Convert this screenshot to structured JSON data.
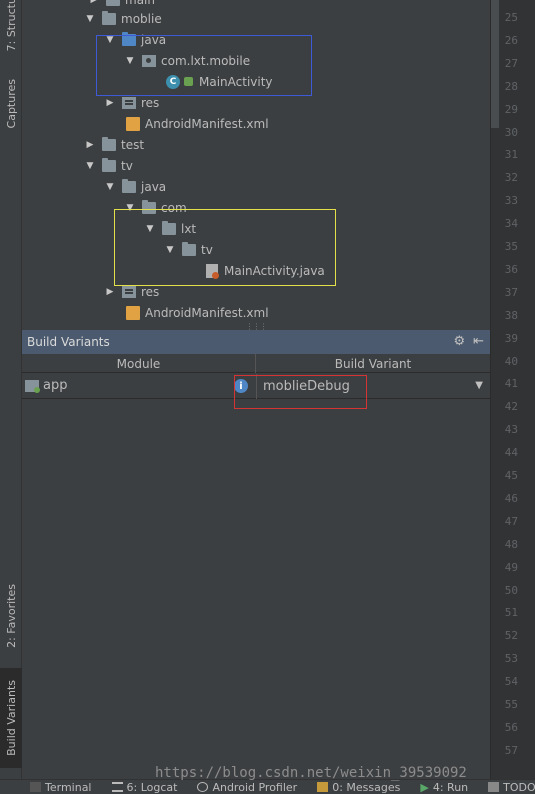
{
  "left_strip": {
    "structure_tab": "7: Structure",
    "captures_tab": "Captures",
    "favorites_tab": "2: Favorites",
    "build_variants_tab": "Build Variants"
  },
  "tree": {
    "rows": [
      {
        "label": "main"
      },
      {
        "label": "moblie"
      },
      {
        "label": "java"
      },
      {
        "label": "com.lxt.mobile"
      },
      {
        "label": "MainActivity"
      },
      {
        "label": "res"
      },
      {
        "label": "AndroidManifest.xml"
      },
      {
        "label": "test"
      },
      {
        "label": "tv"
      },
      {
        "label": "java"
      },
      {
        "label": "com"
      },
      {
        "label": "lxt"
      },
      {
        "label": "tv"
      },
      {
        "label": "MainActivity.java"
      },
      {
        "label": "res"
      },
      {
        "label": "AndroidManifest.xml"
      }
    ]
  },
  "build_variants": {
    "title": "Build Variants",
    "columns": {
      "module": "Module",
      "variant": "Build Variant"
    },
    "row": {
      "module": "app",
      "variant": "moblieDebug"
    }
  },
  "gutter": {
    "line_numbers": [
      "25",
      "26",
      "27",
      "28",
      "29",
      "30",
      "31",
      "32",
      "33",
      "34",
      "35",
      "36",
      "37",
      "38",
      "39",
      "40",
      "41",
      "42",
      "43",
      "44",
      "45",
      "46",
      "47",
      "48",
      "49",
      "50",
      "51",
      "52",
      "53",
      "54",
      "55",
      "56",
      "57"
    ]
  },
  "bottom_bar": {
    "terminal": "Terminal",
    "logcat": "6: Logcat",
    "profiler": "Android Profiler",
    "messages": "0: Messages",
    "run": "4: Run",
    "todo": "TODO"
  },
  "watermark": "https://blog.csdn.net/weixin_39539092",
  "colors": {
    "annotation_blue": "#3f5ad7",
    "annotation_yellow": "#e3e04a",
    "annotation_red": "#d43434",
    "panel_header": "#4b5a6e"
  }
}
